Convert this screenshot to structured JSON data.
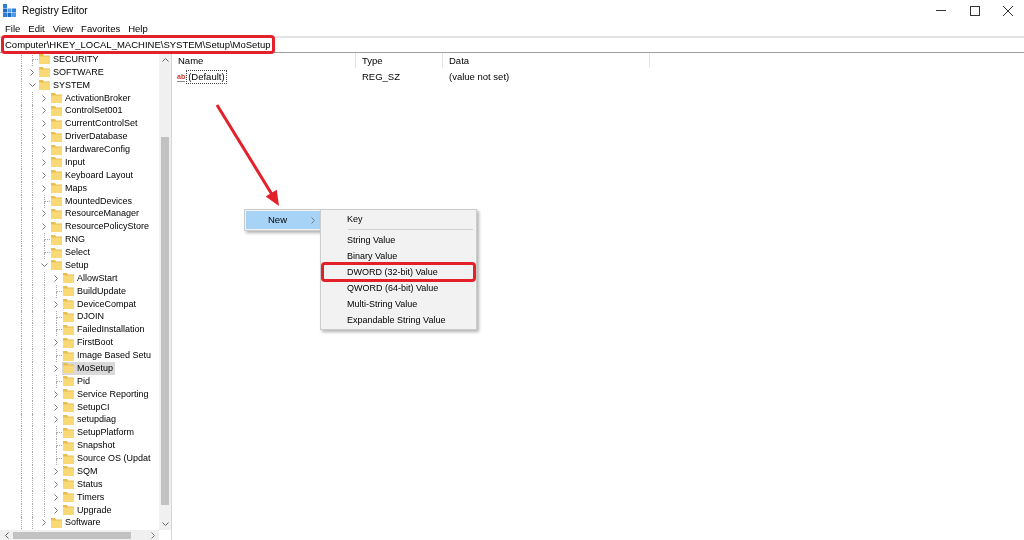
{
  "window": {
    "title": "Registry Editor"
  },
  "menu_bar": [
    "File",
    "Edit",
    "View",
    "Favorites",
    "Help"
  ],
  "address_bar": {
    "value": "Computer\\HKEY_LOCAL_MACHINE\\SYSTEM\\Setup\\MoSetup",
    "highlighted": true
  },
  "tree": {
    "items": [
      {
        "name": "SECURITY",
        "kind": "leaf",
        "selected": false
      },
      {
        "name": "SOFTWARE",
        "kind": "branch",
        "expanded": false,
        "selected": false
      },
      {
        "name": "SYSTEM",
        "kind": "branch",
        "expanded": true,
        "selected": false,
        "children": [
          {
            "name": "ActivationBroker",
            "kind": "branch",
            "expanded": false,
            "selected": false
          },
          {
            "name": "ControlSet001",
            "kind": "branch",
            "expanded": false,
            "selected": false
          },
          {
            "name": "CurrentControlSet",
            "kind": "branch",
            "expanded": false,
            "selected": false
          },
          {
            "name": "DriverDatabase",
            "kind": "branch",
            "expanded": false,
            "selected": false
          },
          {
            "name": "HardwareConfig",
            "kind": "branch",
            "expanded": false,
            "selected": false
          },
          {
            "name": "Input",
            "kind": "branch",
            "expanded": false,
            "selected": false
          },
          {
            "name": "Keyboard Layout",
            "kind": "branch",
            "expanded": false,
            "selected": false
          },
          {
            "name": "Maps",
            "kind": "branch",
            "expanded": false,
            "selected": false
          },
          {
            "name": "MountedDevices",
            "kind": "leaf",
            "selected": false
          },
          {
            "name": "ResourceManager",
            "kind": "branch",
            "expanded": false,
            "selected": false
          },
          {
            "name": "ResourcePolicyStore",
            "kind": "branch",
            "expanded": false,
            "selected": false
          },
          {
            "name": "RNG",
            "kind": "leaf",
            "selected": false
          },
          {
            "name": "Select",
            "kind": "leaf",
            "selected": false
          },
          {
            "name": "Setup",
            "kind": "branch",
            "expanded": true,
            "selected": false,
            "children": [
              {
                "name": "AllowStart",
                "kind": "branch",
                "expanded": false,
                "selected": false
              },
              {
                "name": "BuildUpdate",
                "kind": "leaf",
                "selected": false
              },
              {
                "name": "DeviceCompat",
                "kind": "branch",
                "expanded": false,
                "selected": false
              },
              {
                "name": "DJOIN",
                "kind": "leaf",
                "selected": false
              },
              {
                "name": "FailedInstallation",
                "kind": "leaf",
                "selected": false
              },
              {
                "name": "FirstBoot",
                "kind": "branch",
                "expanded": false,
                "selected": false
              },
              {
                "name": "Image Based Setu",
                "kind": "leaf",
                "selected": false
              },
              {
                "name": "MoSetup",
                "kind": "branch",
                "expanded": false,
                "selected": true
              },
              {
                "name": "Pid",
                "kind": "leaf",
                "selected": false
              },
              {
                "name": "Service Reporting",
                "kind": "branch",
                "expanded": false,
                "selected": false
              },
              {
                "name": "SetupCI",
                "kind": "branch",
                "expanded": false,
                "selected": false
              },
              {
                "name": "setupdiag",
                "kind": "branch",
                "expanded": false,
                "selected": false
              },
              {
                "name": "SetupPlatform",
                "kind": "leaf",
                "selected": false
              },
              {
                "name": "Snapshot",
                "kind": "leaf",
                "selected": false
              },
              {
                "name": "Source OS (Updat",
                "kind": "leaf",
                "selected": false
              },
              {
                "name": "SQM",
                "kind": "branch",
                "expanded": false,
                "selected": false
              },
              {
                "name": "Status",
                "kind": "branch",
                "expanded": false,
                "selected": false
              },
              {
                "name": "Timers",
                "kind": "branch",
                "expanded": false,
                "selected": false
              },
              {
                "name": "Upgrade",
                "kind": "branch",
                "expanded": false,
                "selected": false
              }
            ]
          },
          {
            "name": "Software",
            "kind": "branch",
            "expanded": false,
            "selected": false
          }
        ]
      }
    ]
  },
  "values_table": {
    "columns": [
      "Name",
      "Type",
      "Data"
    ],
    "rows": [
      {
        "icon": "ab",
        "name": "(Default)",
        "type": "REG_SZ",
        "data": "(value not set)",
        "focused": true
      }
    ]
  },
  "context_menu": {
    "items": [
      {
        "label": "New",
        "selected": true,
        "submenu": [
          {
            "kind": "item",
            "label": "Key",
            "highlighted": false
          },
          {
            "kind": "separator"
          },
          {
            "kind": "item",
            "label": "String Value",
            "highlighted": false
          },
          {
            "kind": "item",
            "label": "Binary Value",
            "highlighted": false
          },
          {
            "kind": "item",
            "label": "DWORD (32-bit) Value",
            "highlighted": true
          },
          {
            "kind": "item",
            "label": "QWORD (64-bit) Value",
            "highlighted": false
          },
          {
            "kind": "item",
            "label": "Multi-String Value",
            "highlighted": false
          },
          {
            "kind": "item",
            "label": "Expandable String Value",
            "highlighted": false
          }
        ]
      }
    ]
  }
}
